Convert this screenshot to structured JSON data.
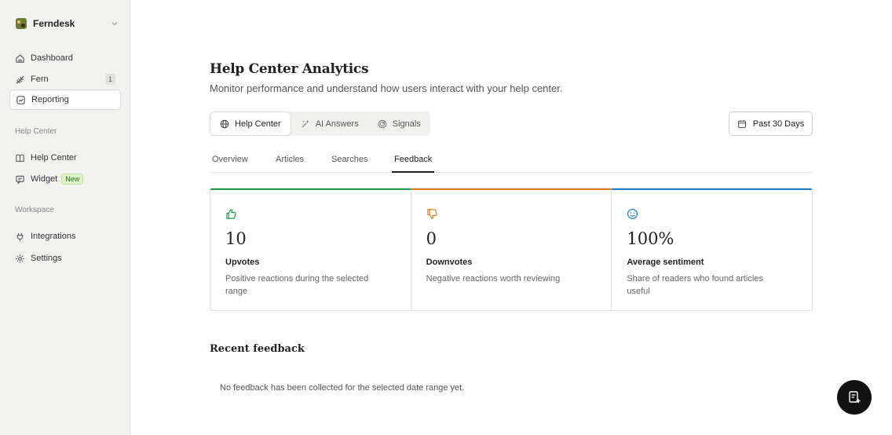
{
  "workspace": {
    "name": "Ferndesk"
  },
  "sidebar": {
    "primary": [
      {
        "label": "Dashboard",
        "icon": "home-icon"
      },
      {
        "label": "Fern",
        "icon": "fern-icon",
        "count": "1"
      },
      {
        "label": "Reporting",
        "icon": "chart-icon",
        "active": true
      }
    ],
    "help_center_heading": "Help Center",
    "help_center": [
      {
        "label": "Help Center",
        "icon": "book-icon"
      },
      {
        "label": "Widget",
        "icon": "chat-icon",
        "badge": "New"
      }
    ],
    "workspace_heading": "Workspace",
    "workspace_items": [
      {
        "label": "Integrations",
        "icon": "plug-icon"
      },
      {
        "label": "Settings",
        "icon": "gear-icon"
      }
    ]
  },
  "header": {
    "title": "Help Center Analytics",
    "subtitle": "Monitor performance and understand how users interact with your help center."
  },
  "segments": [
    {
      "label": "Help Center",
      "icon": "globe-icon",
      "active": true
    },
    {
      "label": "AI Answers",
      "icon": "sparkle-icon"
    },
    {
      "label": "Signals",
      "icon": "signal-icon"
    }
  ],
  "date_range": {
    "label": "Past 30 Days",
    "icon": "calendar-icon"
  },
  "tabs": [
    {
      "label": "Overview"
    },
    {
      "label": "Articles"
    },
    {
      "label": "Searches"
    },
    {
      "label": "Feedback",
      "active": true
    }
  ],
  "stats": [
    {
      "value": "10",
      "label": "Upvotes",
      "description": "Positive reactions during the selected range",
      "icon": "thumbs-up-icon",
      "color": "#1f9d48"
    },
    {
      "value": "0",
      "label": "Downvotes",
      "description": "Negative reactions worth reviewing",
      "icon": "thumbs-down-icon",
      "color": "#e07b12"
    },
    {
      "value": "100%",
      "label": "Average sentiment",
      "description": "Share of readers who found articles useful",
      "icon": "smile-icon",
      "color": "#1a7fc9"
    }
  ],
  "recent_feedback": {
    "title": "Recent feedback",
    "empty_message": "No feedback has been collected for the selected date range yet."
  },
  "fab": {
    "icon": "compose-icon"
  }
}
